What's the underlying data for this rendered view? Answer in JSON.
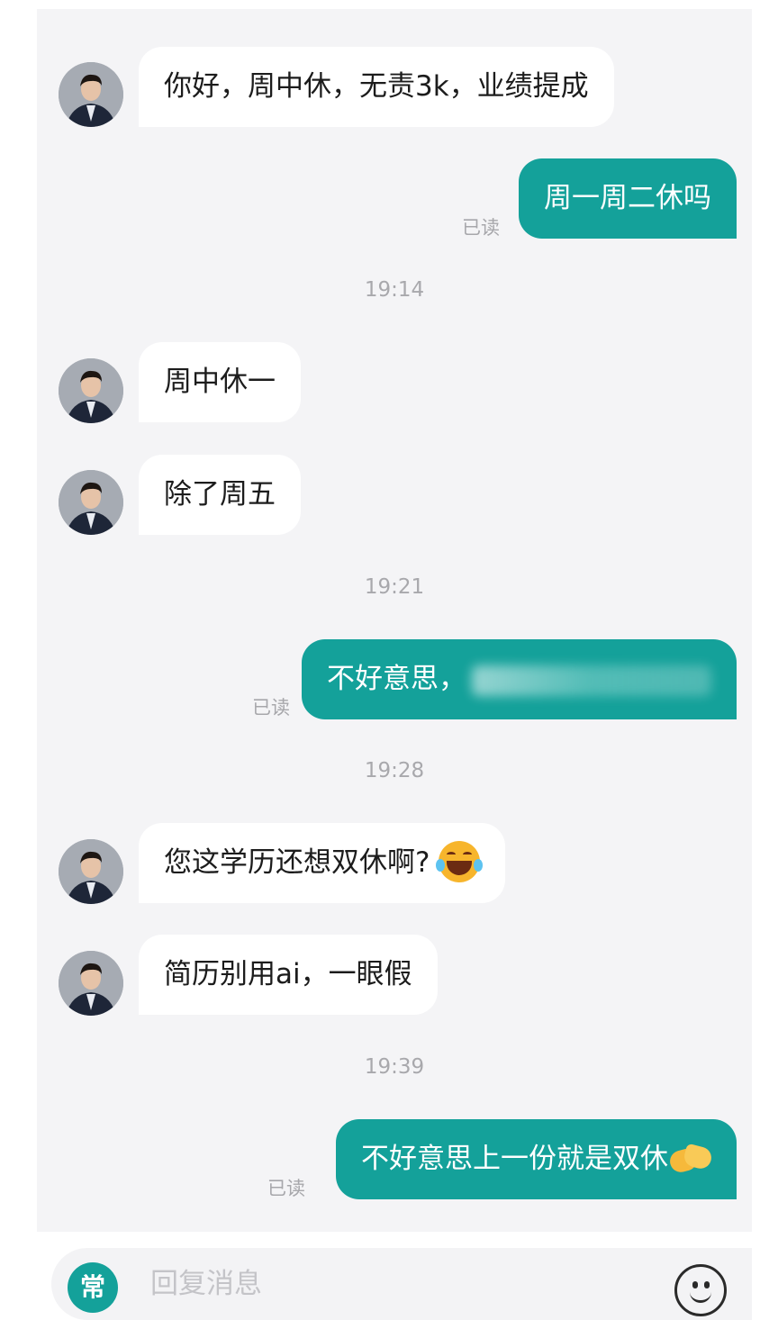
{
  "messages": [
    {
      "side": "in",
      "text": "你好，周中休，无责3k，业绩提成"
    },
    {
      "side": "out",
      "text": "周一周二休吗",
      "status": "已读"
    },
    {
      "time": "19:14"
    },
    {
      "side": "in",
      "text": "周中休一"
    },
    {
      "side": "in",
      "text": "除了周五"
    },
    {
      "time": "19:21"
    },
    {
      "side": "out",
      "text": "不好意思，",
      "status": "已读",
      "partially_obscured": true
    },
    {
      "time": "19:28"
    },
    {
      "side": "in",
      "text": "您这学历还想双休啊?",
      "emoji": "laughing-tears-emoji"
    },
    {
      "side": "in",
      "text": "简历别用ai，一眼假"
    },
    {
      "time": "19:39"
    },
    {
      "side": "out",
      "text": "不好意思上一份就是双休",
      "status": "已读",
      "emoji": "handshake-emoji"
    }
  ],
  "composer": {
    "quick_button": "常",
    "placeholder": "回复消息",
    "emoji_icon": "smiley-icon"
  },
  "colors": {
    "accent": "#14a19a",
    "chat_background": "#f4f4f6",
    "incoming_bubble": "#ffffff",
    "timestamp_text": "#a8a8ac"
  }
}
